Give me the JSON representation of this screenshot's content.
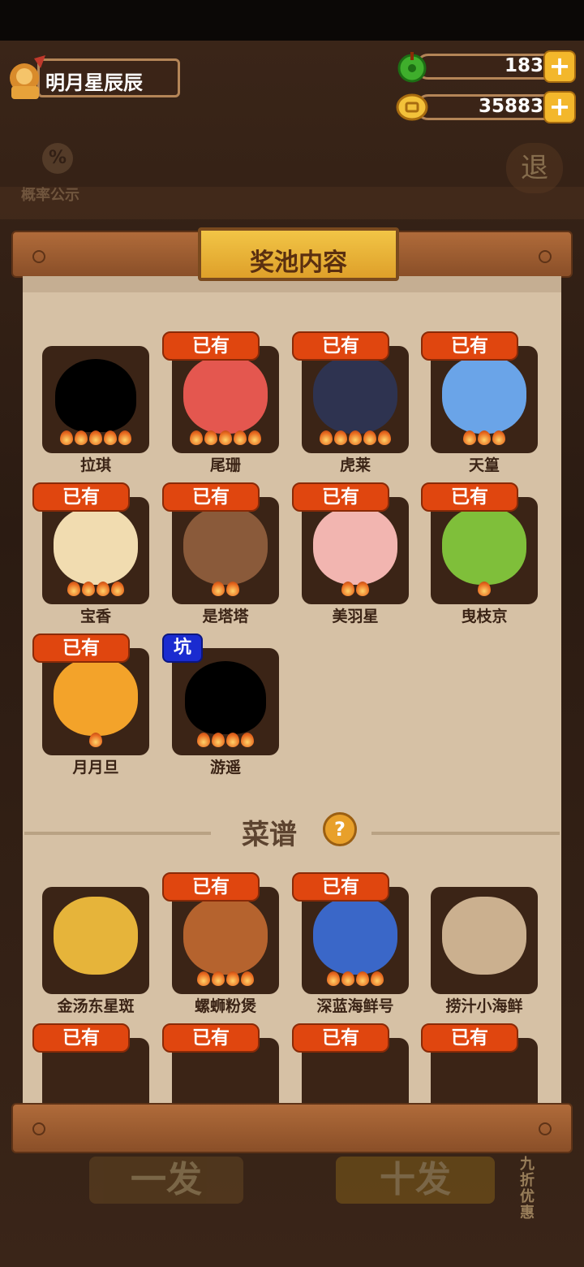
{
  "player": {
    "name": "明月星辰辰"
  },
  "currency": {
    "gems": "183",
    "coins": "35883",
    "plus": "+"
  },
  "background": {
    "probability_label": "概率公示",
    "probability_icon": "%",
    "exit_label": "退",
    "single_draw": "一发",
    "ten_draw": "十发",
    "discount": "九折优惠"
  },
  "modal": {
    "title": "奖池内容",
    "owned_label": "已有",
    "pit_label": "坑",
    "characters": [
      {
        "name": "拉琪",
        "stars": 5,
        "owned": false,
        "silhouette": true,
        "color": "#000000"
      },
      {
        "name": "尾珊",
        "stars": 5,
        "owned": true,
        "color": "#e4574f"
      },
      {
        "name": "虎莱",
        "stars": 5,
        "owned": true,
        "color": "#2e3350"
      },
      {
        "name": "天篁",
        "stars": 3,
        "owned": true,
        "color": "#6aa4e8"
      },
      {
        "name": "宝香",
        "stars": 4,
        "owned": true,
        "color": "#f1dcb0"
      },
      {
        "name": "是塔塔",
        "stars": 2,
        "owned": true,
        "color": "#8a5a3a"
      },
      {
        "name": "美羽星",
        "stars": 2,
        "owned": true,
        "color": "#f2b5b0"
      },
      {
        "name": "曳枝京",
        "stars": 1,
        "owned": true,
        "color": "#7fbf3a"
      },
      {
        "name": "月月旦",
        "stars": 1,
        "owned": true,
        "color": "#f3a32a"
      },
      {
        "name": "游遥",
        "stars": 4,
        "owned": false,
        "pit": true,
        "silhouette": true,
        "color": "#000000"
      }
    ],
    "recipe_section": {
      "title": "菜谱",
      "help_icon": "?"
    },
    "recipes": [
      {
        "name": "金汤东星斑",
        "stars": 0,
        "owned": false,
        "color": "#e6b43a"
      },
      {
        "name": "螺蛳粉煲",
        "stars": 4,
        "owned": true,
        "color": "#b5632e"
      },
      {
        "name": "深蓝海鲜号",
        "stars": 4,
        "owned": true,
        "color": "#3a67c8"
      },
      {
        "name": "捞汁小海鲜",
        "stars": 0,
        "owned": false,
        "color": "#cbb08f"
      },
      {
        "name": "",
        "stars": 0,
        "owned": true,
        "color": "#3b2416"
      },
      {
        "name": "",
        "stars": 0,
        "owned": true,
        "color": "#3b2416"
      },
      {
        "name": "",
        "stars": 0,
        "owned": true,
        "color": "#3b2416"
      },
      {
        "name": "",
        "stars": 0,
        "owned": true,
        "color": "#3b2416"
      }
    ]
  }
}
